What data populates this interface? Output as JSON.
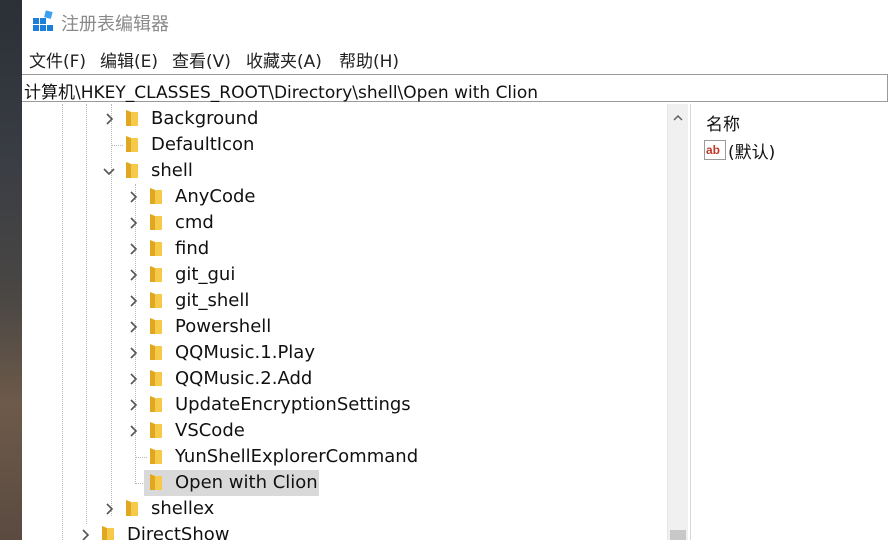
{
  "window": {
    "title": "注册表编辑器"
  },
  "menu": {
    "items": [
      {
        "label": "文件(F)"
      },
      {
        "label": "编辑(E)"
      },
      {
        "label": "查看(V)"
      },
      {
        "label": "收藏夹(A)"
      },
      {
        "label": "帮助(H)"
      }
    ]
  },
  "address": {
    "path": "计算机\\HKEY_CLASSES_ROOT\\Directory\\shell\\Open with Clion"
  },
  "tree": {
    "items": [
      {
        "label": "Background",
        "expander": "collapsed"
      },
      {
        "label": "DefaultIcon",
        "expander": "none"
      },
      {
        "label": "shell",
        "expander": "expanded"
      },
      {
        "label": "AnyCode",
        "expander": "collapsed"
      },
      {
        "label": "cmd",
        "expander": "collapsed"
      },
      {
        "label": "find",
        "expander": "collapsed"
      },
      {
        "label": "git_gui",
        "expander": "collapsed"
      },
      {
        "label": "git_shell",
        "expander": "collapsed"
      },
      {
        "label": "Powershell",
        "expander": "collapsed"
      },
      {
        "label": "QQMusic.1.Play",
        "expander": "collapsed"
      },
      {
        "label": "QQMusic.2.Add",
        "expander": "collapsed"
      },
      {
        "label": "UpdateEncryptionSettings",
        "expander": "collapsed"
      },
      {
        "label": "VSCode",
        "expander": "collapsed"
      },
      {
        "label": "YunShellExplorerCommand",
        "expander": "none"
      },
      {
        "label": "Open with Clion",
        "expander": "none",
        "selected": true
      },
      {
        "label": "shellex",
        "expander": "collapsed"
      },
      {
        "label": "DirectShow",
        "expander": "collapsed"
      }
    ]
  },
  "values": {
    "column_name": "名称",
    "rows": [
      {
        "name": "(默认)",
        "icon": "string-value-icon"
      }
    ]
  },
  "colors": {
    "folder": "#f7c948",
    "selection": "#d9d9d9",
    "title_text": "#8a8a8a"
  }
}
